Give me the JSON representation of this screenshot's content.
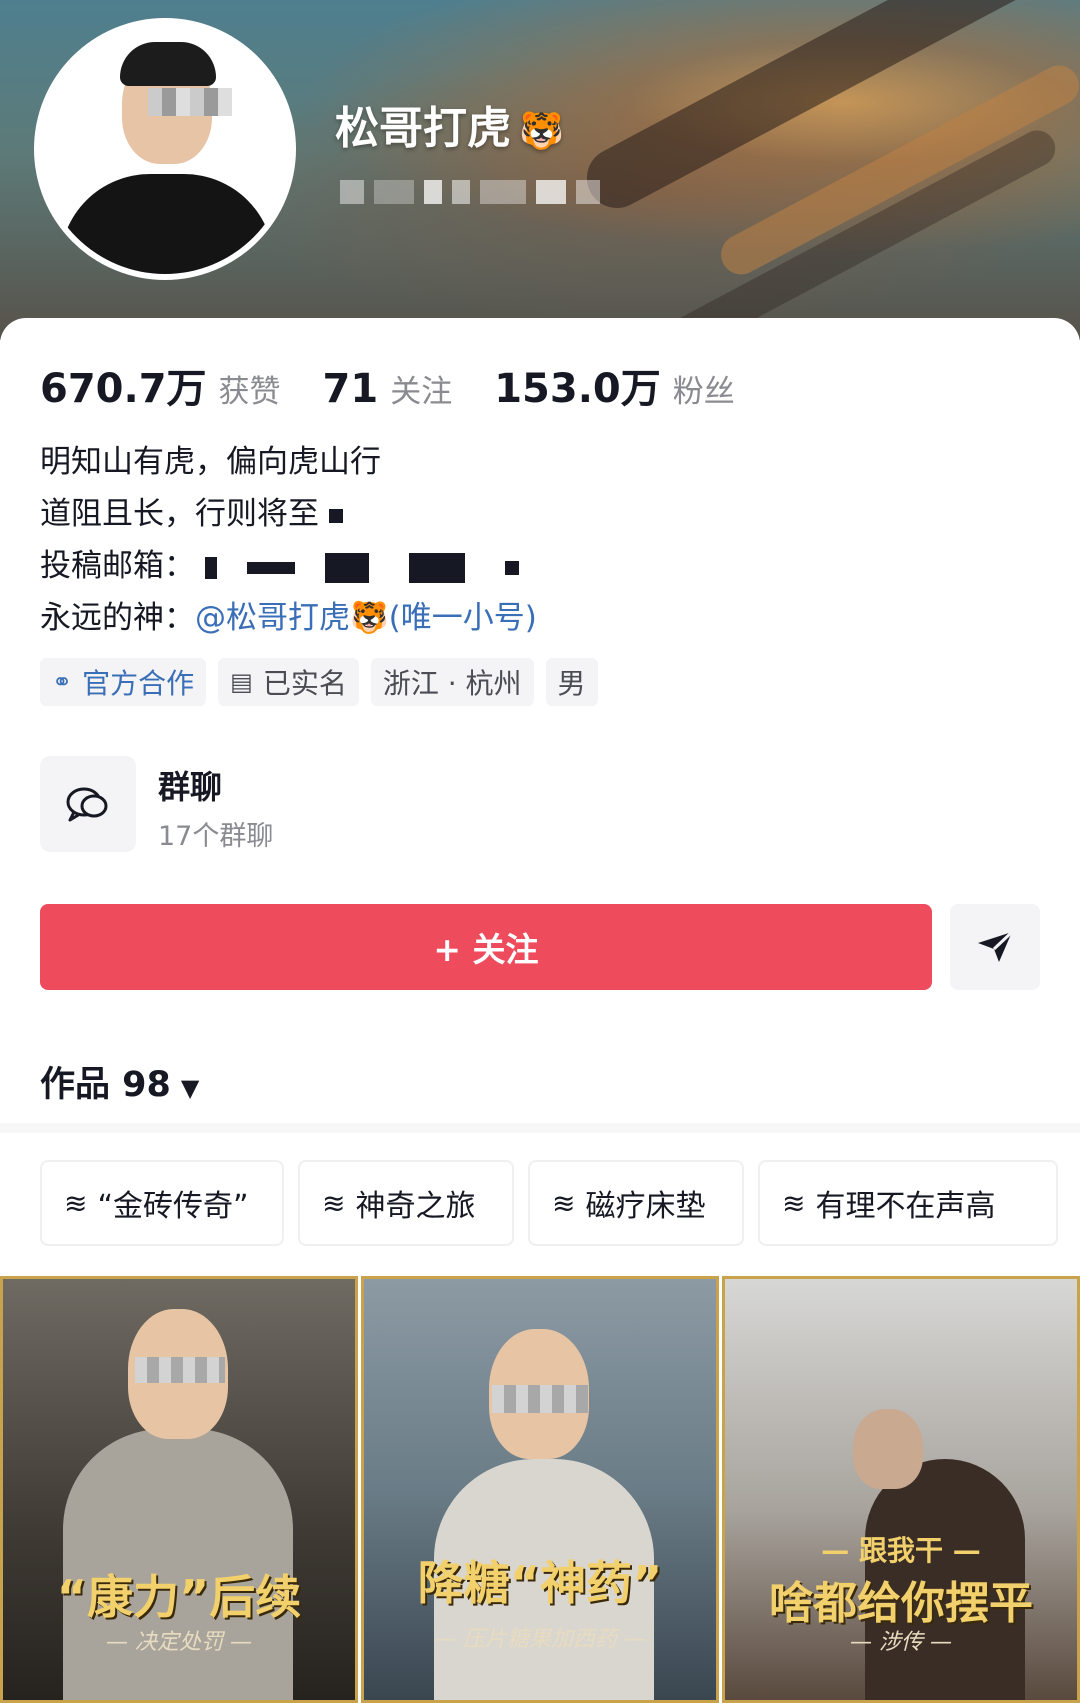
{
  "profile": {
    "username": "松哥打虎",
    "username_emoji": "🐯"
  },
  "stats": [
    {
      "value": "670.7万",
      "label": "获赞"
    },
    {
      "value": "71",
      "label": "关注"
    },
    {
      "value": "153.0万",
      "label": "粉丝"
    }
  ],
  "bio": {
    "line1": "明知山有虎，偏向虎山行",
    "line2": "道阻且长，行则将至",
    "email_label": "投稿邮箱：",
    "god_label": "永远的神：",
    "god_mention": "@松哥打虎🐯(唯一小号)"
  },
  "tags": {
    "official": "官方合作",
    "verified": "已实名",
    "location": "浙江 · 杭州",
    "gender": "男"
  },
  "group_chat": {
    "title": "群聊",
    "count": "17个群聊"
  },
  "actions": {
    "follow": "+ 关注",
    "share_icon": "paper-plane-icon"
  },
  "works": {
    "label": "作品 98",
    "arrow": "▼"
  },
  "collections": [
    "“金砖传奇”",
    "神奇之旅",
    "磁疗床垫",
    "有理不在声高"
  ],
  "videos": [
    {
      "caption": "“康力”后续",
      "subcaption": "— 决定处罚 —"
    },
    {
      "caption": "降糖“神药”",
      "subcaption": "— 压片糖果加西药 —"
    },
    {
      "title_small": "— 跟我干 —",
      "caption": "啥都给你摆平",
      "subcaption": "— 涉传 —"
    }
  ],
  "colors": {
    "follow_button": "#ee4b5d",
    "mention": "#3a6fb7",
    "caption_gold": "#f2d06b"
  }
}
